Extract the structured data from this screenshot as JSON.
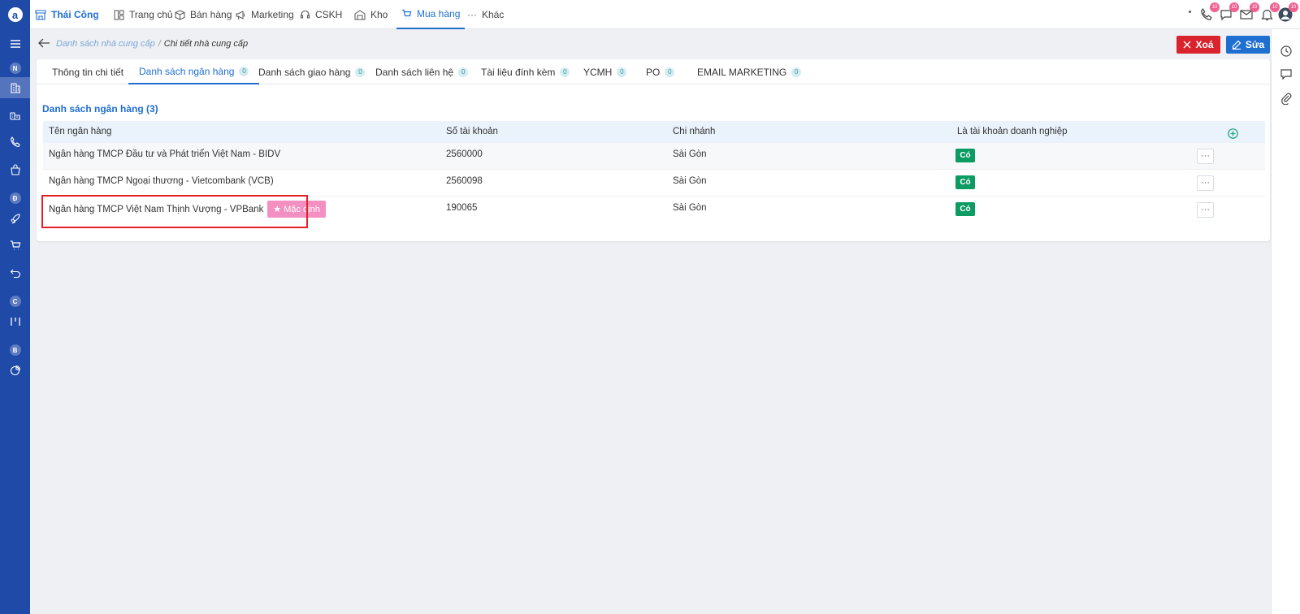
{
  "topbar": {
    "brand": "Thái Công",
    "nav": [
      "Trang chủ",
      "Bán hàng",
      "Marketing",
      "CSKH",
      "Kho",
      "Mua hàng",
      "Khác"
    ],
    "badges": [
      "10",
      "10",
      "10",
      "10",
      "10"
    ]
  },
  "sidebar": {
    "letters": [
      "N",
      "Đ",
      "C",
      "B"
    ]
  },
  "breadcrumb": {
    "parent": "Danh sách nhà cung cấp",
    "separator": "/",
    "current": "Chi tiết nhà cung cấp"
  },
  "actions": {
    "delete": "Xoá",
    "edit": "Sửa"
  },
  "tabs": [
    {
      "label": "Thông tin chi tiết",
      "count": ""
    },
    {
      "label": "Danh sách ngân hàng",
      "count": "0"
    },
    {
      "label": "Danh sách giao hàng",
      "count": "0"
    },
    {
      "label": "Danh sách liên hệ",
      "count": "0"
    },
    {
      "label": "Tài liệu đính kèm",
      "count": "0"
    },
    {
      "label": "YCMH",
      "count": "0"
    },
    {
      "label": "PO",
      "count": "0"
    },
    {
      "label": "EMAIL MARKETING",
      "count": "0"
    }
  ],
  "section_title": "Danh sách ngân hàng (3)",
  "table": {
    "headers": [
      "Tên ngân hàng",
      "Số tài khoản",
      "Chi nhánh",
      "Là tài khoản doanh nghiệp"
    ],
    "rows": [
      {
        "bank": "Ngân hàng TMCP Đầu tư và Phát triển Việt Nam - BIDV",
        "account": "2560000",
        "branch": "Sài Gòn",
        "business": "Có"
      },
      {
        "bank": "Ngân hàng TMCP Ngoại thương - Vietcombank (VCB)",
        "account": "2560098",
        "branch": "Sài Gòn",
        "business": "Có"
      },
      {
        "bank": "Ngân hàng TMCP Việt Nam Thịnh Vượng - VPBank",
        "account": "190065",
        "branch": "Sài Gòn",
        "business": "Có",
        "default_label": "Mặc định"
      }
    ],
    "more_label": "···"
  },
  "colors": {
    "sidebar": "#1f4aa8",
    "accent": "#1f6fd1",
    "danger": "#d9232d",
    "success": "#0c9b63",
    "default_badge": "#f48fc1"
  }
}
